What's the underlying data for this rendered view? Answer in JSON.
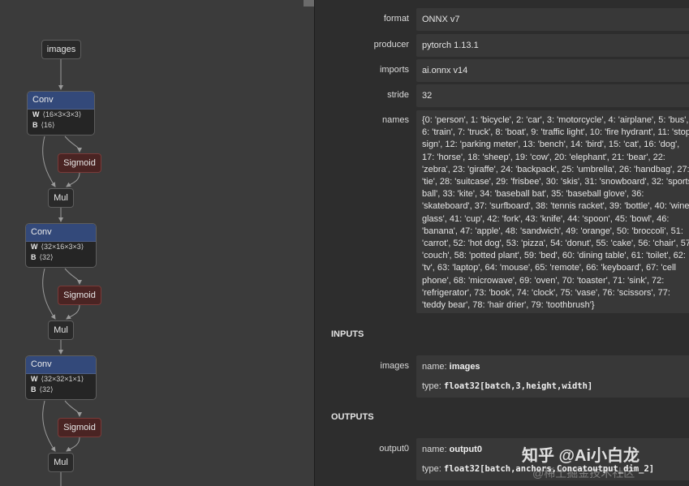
{
  "graph": {
    "input_node": "images",
    "blocks": [
      {
        "op": "Conv",
        "w_key": "W",
        "w_shape": "⟨16×3×3×3⟩",
        "b_key": "B",
        "b_shape": "⟨16⟩",
        "activation": "Sigmoid",
        "mul": "Mul"
      },
      {
        "op": "Conv",
        "w_key": "W",
        "w_shape": "⟨32×16×3×3⟩",
        "b_key": "B",
        "b_shape": "⟨32⟩",
        "activation": "Sigmoid",
        "mul": "Mul"
      },
      {
        "op": "Conv",
        "w_key": "W",
        "w_shape": "⟨32×32×1×1⟩",
        "b_key": "B",
        "b_shape": "⟨32⟩",
        "activation": "Sigmoid",
        "mul": "Mul"
      }
    ]
  },
  "properties": {
    "format": {
      "label": "format",
      "value": "ONNX v7"
    },
    "producer": {
      "label": "producer",
      "value": "pytorch 1.13.1"
    },
    "imports": {
      "label": "imports",
      "value": "ai.onnx v14"
    },
    "stride": {
      "label": "stride",
      "value": "32"
    },
    "names": {
      "label": "names",
      "value": "{0: 'person', 1: 'bicycle', 2: 'car', 3: 'motorcycle', 4: 'airplane', 5: 'bus', 6: 'train', 7: 'truck', 8: 'boat', 9: 'traffic light', 10: 'fire hydrant', 11: 'stop sign', 12: 'parking meter', 13: 'bench', 14: 'bird', 15: 'cat', 16: 'dog', 17: 'horse', 18: 'sheep', 19: 'cow', 20: 'elephant', 21: 'bear', 22: 'zebra', 23: 'giraffe', 24: 'backpack', 25: 'umbrella', 26: 'handbag', 27: 'tie', 28: 'suitcase', 29: 'frisbee', 30: 'skis', 31: 'snowboard', 32: 'sports ball', 33: 'kite', 34: 'baseball bat', 35: 'baseball glove', 36: 'skateboard', 37: 'surfboard', 38: 'tennis racket', 39: 'bottle', 40: 'wine glass', 41: 'cup', 42: 'fork', 43: 'knife', 44: 'spoon', 45: 'bowl', 46: 'banana', 47: 'apple', 48: 'sandwich', 49: 'orange', 50: 'broccoli', 51: 'carrot', 52: 'hot dog', 53: 'pizza', 54: 'donut', 55: 'cake', 56: 'chair', 57: 'couch', 58: 'potted plant', 59: 'bed', 60: 'dining table', 61: 'toilet', 62: 'tv', 63: 'laptop', 64: 'mouse', 65: 'remote', 66: 'keyboard', 67: 'cell phone', 68: 'microwave', 69: 'oven', 70: 'toaster', 71: 'sink', 72: 'refrigerator', 73: 'book', 74: 'clock', 75: 'vase', 76: 'scissors', 77: 'teddy bear', 78: 'hair drier', 79: 'toothbrush'}"
    }
  },
  "inputs": {
    "heading": "INPUTS",
    "items": [
      {
        "label": "images",
        "name_key": "name:",
        "name": "images",
        "type_key": "type:",
        "type": "float32[batch,3,height,width]"
      }
    ]
  },
  "outputs": {
    "heading": "OUTPUTS",
    "items": [
      {
        "label": "output0",
        "name_key": "name:",
        "name": "output0",
        "type_key": "type:",
        "type": "float32[batch,anchors,Concatoutput_dim_2]"
      }
    ]
  },
  "watermark": {
    "main": "知乎 @Ai小白龙",
    "sub": "@稀土掘金技术社区"
  },
  "colors": {
    "conv_header": "#33497a",
    "sigmoid_node": "#4a2423",
    "graph_bg": "#3b3b3b",
    "props_bg": "#2d2d2d"
  }
}
